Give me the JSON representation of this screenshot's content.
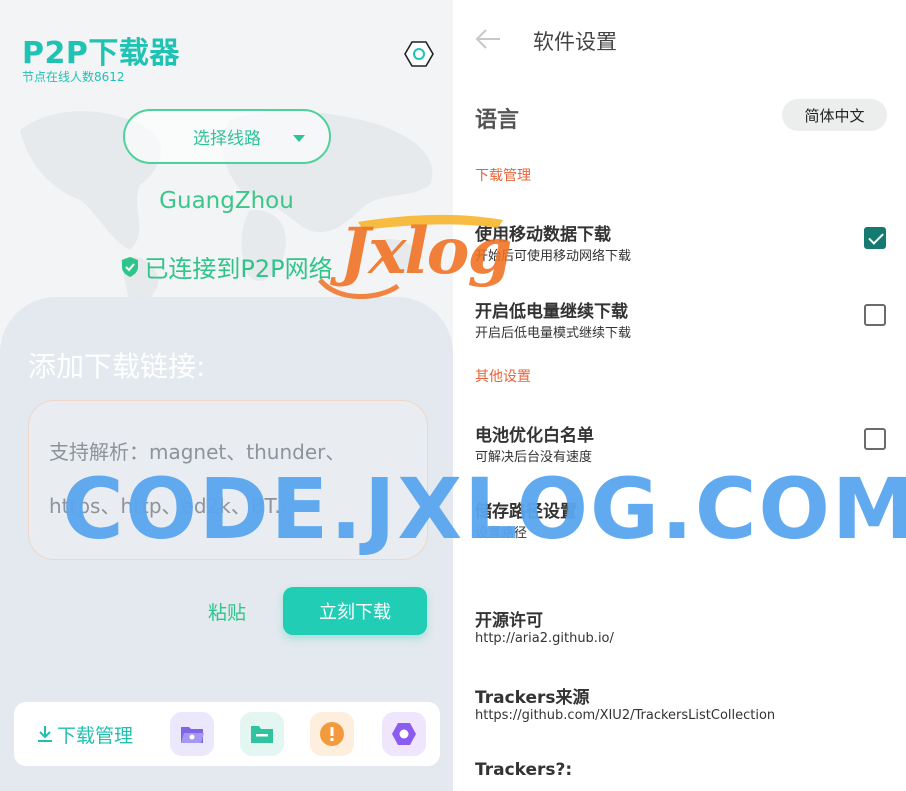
{
  "left": {
    "app_title": "P2P下载器",
    "online_count": "节点在线人数8612",
    "route_select_label": "选择线路",
    "city": "GuangZhou",
    "status": "已连接到P2P网络",
    "add_title": "添加下载链接:",
    "url_placeholder": "支持解析：magnet、thunder、https、http、ed2k、BT...",
    "paste_label": "粘贴",
    "download_label": "立刻下载",
    "bottom_bar": {
      "download_manage_label": "下载管理",
      "buttons": [
        {
          "icon": "folder-open-icon",
          "color": "#7e66e6",
          "bg": "#ebe8fb"
        },
        {
          "icon": "folder-icon",
          "color": "#2fc3a0",
          "bg": "#e4f6f1"
        },
        {
          "icon": "alert-icon",
          "color": "#f39b3c",
          "bg": "#fdeedd"
        },
        {
          "icon": "settings-icon",
          "color": "#8c5cf0",
          "bg": "#efe6fd"
        }
      ]
    }
  },
  "right": {
    "title": "软件设置",
    "language_label": "语言",
    "language_value": "简体中文",
    "sections": {
      "download_manage": "下载管理",
      "other_settings": "其他设置"
    },
    "settings": {
      "mobile_data": {
        "title": "使用移动数据下载",
        "sub": "开始后可使用移动网络下载",
        "checked": true
      },
      "low_battery": {
        "title": "开启低电量继续下载",
        "sub": "开启后低电量模式继续下载",
        "checked": false
      },
      "battery_whitelist": {
        "title": "电池优化白名单",
        "sub": "可解决后台没有速度",
        "checked": false
      },
      "storage_path": {
        "title": "储存路径设置",
        "sub": "设置路径"
      },
      "open_source": {
        "title": "开源许可",
        "sub": "http://aria2.github.io/"
      },
      "trackers_source": {
        "title": "Trackers来源",
        "sub": "https://github.com/XIU2/TrackersListCollection"
      },
      "trackers": {
        "title": "Trackers?:",
        "sub": ""
      }
    }
  },
  "watermarks": {
    "logo": "Jxlog",
    "site": "CODE.JXLOG.COM"
  },
  "colors": {
    "accent": "#1fc3b4",
    "green": "#2fc58a",
    "section_header": "#e8643a",
    "checkbox_checked": "#157a6f"
  }
}
